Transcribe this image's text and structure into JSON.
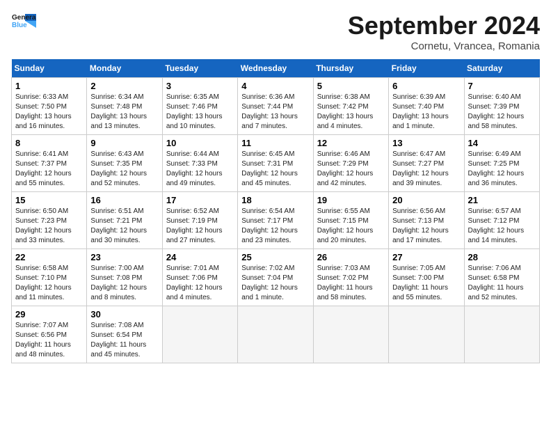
{
  "header": {
    "logo_line1": "General",
    "logo_line2": "Blue",
    "month": "September 2024",
    "location": "Cornetu, Vrancea, Romania"
  },
  "days_of_week": [
    "Sunday",
    "Monday",
    "Tuesday",
    "Wednesday",
    "Thursday",
    "Friday",
    "Saturday"
  ],
  "weeks": [
    [
      {
        "day": 1,
        "lines": [
          "Sunrise: 6:33 AM",
          "Sunset: 7:50 PM",
          "Daylight: 13 hours",
          "and 16 minutes."
        ]
      },
      {
        "day": 2,
        "lines": [
          "Sunrise: 6:34 AM",
          "Sunset: 7:48 PM",
          "Daylight: 13 hours",
          "and 13 minutes."
        ]
      },
      {
        "day": 3,
        "lines": [
          "Sunrise: 6:35 AM",
          "Sunset: 7:46 PM",
          "Daylight: 13 hours",
          "and 10 minutes."
        ]
      },
      {
        "day": 4,
        "lines": [
          "Sunrise: 6:36 AM",
          "Sunset: 7:44 PM",
          "Daylight: 13 hours",
          "and 7 minutes."
        ]
      },
      {
        "day": 5,
        "lines": [
          "Sunrise: 6:38 AM",
          "Sunset: 7:42 PM",
          "Daylight: 13 hours",
          "and 4 minutes."
        ]
      },
      {
        "day": 6,
        "lines": [
          "Sunrise: 6:39 AM",
          "Sunset: 7:40 PM",
          "Daylight: 13 hours",
          "and 1 minute."
        ]
      },
      {
        "day": 7,
        "lines": [
          "Sunrise: 6:40 AM",
          "Sunset: 7:39 PM",
          "Daylight: 12 hours",
          "and 58 minutes."
        ]
      }
    ],
    [
      {
        "day": 8,
        "lines": [
          "Sunrise: 6:41 AM",
          "Sunset: 7:37 PM",
          "Daylight: 12 hours",
          "and 55 minutes."
        ]
      },
      {
        "day": 9,
        "lines": [
          "Sunrise: 6:43 AM",
          "Sunset: 7:35 PM",
          "Daylight: 12 hours",
          "and 52 minutes."
        ]
      },
      {
        "day": 10,
        "lines": [
          "Sunrise: 6:44 AM",
          "Sunset: 7:33 PM",
          "Daylight: 12 hours",
          "and 49 minutes."
        ]
      },
      {
        "day": 11,
        "lines": [
          "Sunrise: 6:45 AM",
          "Sunset: 7:31 PM",
          "Daylight: 12 hours",
          "and 45 minutes."
        ]
      },
      {
        "day": 12,
        "lines": [
          "Sunrise: 6:46 AM",
          "Sunset: 7:29 PM",
          "Daylight: 12 hours",
          "and 42 minutes."
        ]
      },
      {
        "day": 13,
        "lines": [
          "Sunrise: 6:47 AM",
          "Sunset: 7:27 PM",
          "Daylight: 12 hours",
          "and 39 minutes."
        ]
      },
      {
        "day": 14,
        "lines": [
          "Sunrise: 6:49 AM",
          "Sunset: 7:25 PM",
          "Daylight: 12 hours",
          "and 36 minutes."
        ]
      }
    ],
    [
      {
        "day": 15,
        "lines": [
          "Sunrise: 6:50 AM",
          "Sunset: 7:23 PM",
          "Daylight: 12 hours",
          "and 33 minutes."
        ]
      },
      {
        "day": 16,
        "lines": [
          "Sunrise: 6:51 AM",
          "Sunset: 7:21 PM",
          "Daylight: 12 hours",
          "and 30 minutes."
        ]
      },
      {
        "day": 17,
        "lines": [
          "Sunrise: 6:52 AM",
          "Sunset: 7:19 PM",
          "Daylight: 12 hours",
          "and 27 minutes."
        ]
      },
      {
        "day": 18,
        "lines": [
          "Sunrise: 6:54 AM",
          "Sunset: 7:17 PM",
          "Daylight: 12 hours",
          "and 23 minutes."
        ]
      },
      {
        "day": 19,
        "lines": [
          "Sunrise: 6:55 AM",
          "Sunset: 7:15 PM",
          "Daylight: 12 hours",
          "and 20 minutes."
        ]
      },
      {
        "day": 20,
        "lines": [
          "Sunrise: 6:56 AM",
          "Sunset: 7:13 PM",
          "Daylight: 12 hours",
          "and 17 minutes."
        ]
      },
      {
        "day": 21,
        "lines": [
          "Sunrise: 6:57 AM",
          "Sunset: 7:12 PM",
          "Daylight: 12 hours",
          "and 14 minutes."
        ]
      }
    ],
    [
      {
        "day": 22,
        "lines": [
          "Sunrise: 6:58 AM",
          "Sunset: 7:10 PM",
          "Daylight: 12 hours",
          "and 11 minutes."
        ]
      },
      {
        "day": 23,
        "lines": [
          "Sunrise: 7:00 AM",
          "Sunset: 7:08 PM",
          "Daylight: 12 hours",
          "and 8 minutes."
        ]
      },
      {
        "day": 24,
        "lines": [
          "Sunrise: 7:01 AM",
          "Sunset: 7:06 PM",
          "Daylight: 12 hours",
          "and 4 minutes."
        ]
      },
      {
        "day": 25,
        "lines": [
          "Sunrise: 7:02 AM",
          "Sunset: 7:04 PM",
          "Daylight: 12 hours",
          "and 1 minute."
        ]
      },
      {
        "day": 26,
        "lines": [
          "Sunrise: 7:03 AM",
          "Sunset: 7:02 PM",
          "Daylight: 11 hours",
          "and 58 minutes."
        ]
      },
      {
        "day": 27,
        "lines": [
          "Sunrise: 7:05 AM",
          "Sunset: 7:00 PM",
          "Daylight: 11 hours",
          "and 55 minutes."
        ]
      },
      {
        "day": 28,
        "lines": [
          "Sunrise: 7:06 AM",
          "Sunset: 6:58 PM",
          "Daylight: 11 hours",
          "and 52 minutes."
        ]
      }
    ],
    [
      {
        "day": 29,
        "lines": [
          "Sunrise: 7:07 AM",
          "Sunset: 6:56 PM",
          "Daylight: 11 hours",
          "and 48 minutes."
        ]
      },
      {
        "day": 30,
        "lines": [
          "Sunrise: 7:08 AM",
          "Sunset: 6:54 PM",
          "Daylight: 11 hours",
          "and 45 minutes."
        ]
      },
      null,
      null,
      null,
      null,
      null
    ]
  ]
}
